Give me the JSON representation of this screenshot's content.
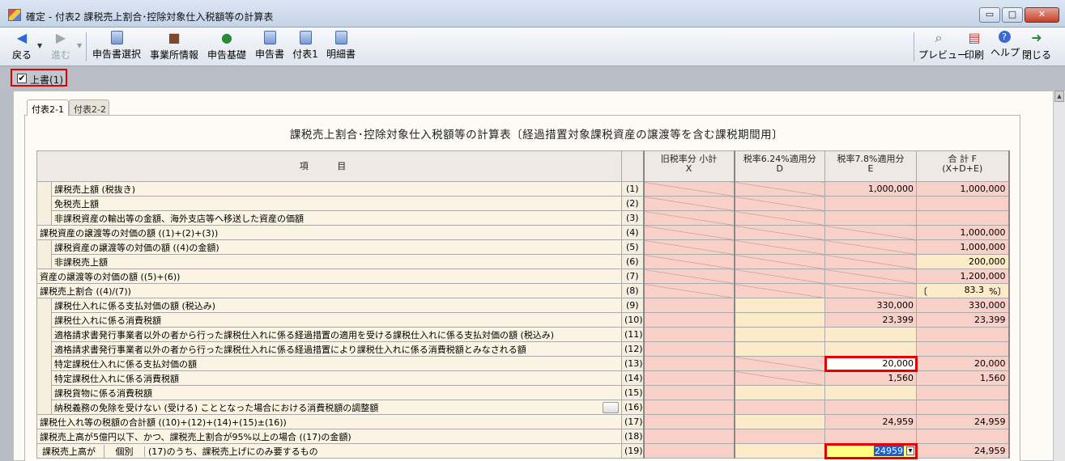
{
  "window": {
    "title": "確定 - 付表2 課税売上割合･控除対象仕入税額等の計算表",
    "min_label": "▭",
    "max_label": "□",
    "close_label": "✕"
  },
  "toolbar": {
    "back": "戻る",
    "forward": "進む",
    "select_return": "申告書選択",
    "business_info": "事業所情報",
    "base": "申告基礎",
    "return_form": "申告書",
    "appendix1": "付表1",
    "details": "明細書",
    "preview": "プレビュー",
    "print": "印刷",
    "help": "ヘルプ",
    "close": "閉じる"
  },
  "overwrite": {
    "label": "上書(1)",
    "checked": "✔"
  },
  "tabs": [
    "付表2-1",
    "付表2-2"
  ],
  "page_title": "課税売上割合･控除対象仕入税額等の計算表〔経過措置対象課税資産の譲渡等を含む課税期間用〕",
  "columns": {
    "item": "項 目",
    "x_line1": "旧税率分 小計",
    "x_line2": "X",
    "d_line1": "税率6.24%適用分",
    "d_line2": "D",
    "e_line1": "税率7.8%適用分",
    "e_line2": "E",
    "f_line1": "合 計 F",
    "f_line2": "(X+D+E)"
  },
  "rows": [
    {
      "label": "課税売上額 (税抜き)",
      "num": "(1)",
      "e": "1,000,000",
      "f": "1,000,000"
    },
    {
      "label": "免税売上額",
      "num": "(2)",
      "e": "",
      "f": ""
    },
    {
      "label": "非課税資産の輸出等の金額、海外支店等へ移送した資産の価額",
      "num": "(3)",
      "e": "",
      "f": ""
    },
    {
      "label": "課税資産の譲渡等の対価の額 ((1)+(2)+(3))",
      "num": "(4)",
      "f": "1,000,000"
    },
    {
      "label": "課税資産の譲渡等の対価の額 ((4)の金額)",
      "num": "(5)",
      "f": "1,000,000"
    },
    {
      "label": "非課税売上額",
      "num": "(6)",
      "f": "200,000"
    },
    {
      "label": "資産の譲渡等の対価の額 ((5)+(6))",
      "num": "(7)",
      "f": "1,200,000"
    },
    {
      "label": "課税売上割合 ((4)/(7))",
      "num": "(8)",
      "f_open": "〔",
      "f": "83.3",
      "f_close": "%〕"
    },
    {
      "label": "課税仕入れに係る支払対価の額 (税込み)",
      "num": "(9)",
      "e": "330,000",
      "f": "330,000"
    },
    {
      "label": "課税仕入れに係る消費税額",
      "num": "(10)",
      "e": "23,399",
      "f": "23,399"
    },
    {
      "label": "適格請求書発行事業者以外の者から行った課税仕入れに係る経過措置の適用を受ける課税仕入れに係る支払対価の額 (税込み)",
      "num": "(11)",
      "e": "",
      "f": ""
    },
    {
      "label": "適格請求書発行事業者以外の者から行った課税仕入れに係る経過措置により課税仕入れに係る消費税額とみなされる額",
      "num": "(12)",
      "e": "",
      "f": ""
    },
    {
      "label": "特定課税仕入れに係る支払対価の額",
      "num": "(13)",
      "e": "20,000",
      "f": "20,000"
    },
    {
      "label": "特定課税仕入れに係る消費税額",
      "num": "(14)",
      "e": "1,560",
      "f": "1,560"
    },
    {
      "label": "課税貨物に係る消費税額",
      "num": "(15)",
      "e": "",
      "f": ""
    },
    {
      "label": "納税義務の免除を受けない (受ける) こととなった場合における消費税額の調整額",
      "num": "(16)",
      "e": "",
      "f": ""
    },
    {
      "label": "課税仕入れ等の税額の合計額 ((10)+(12)+(14)+(15)±(16))",
      "num": "(17)",
      "e": "24,959",
      "f": "24,959"
    },
    {
      "label": "課税売上高が5億円以下、かつ、課税売上割合が95%以上の場合 ((17)の金額)",
      "num": "(18)",
      "e": "",
      "f": ""
    },
    {
      "label": "(17)のうち、課税売上げにのみ要するもの",
      "num": "(19)",
      "e": "24959",
      "f": "24,959"
    }
  ],
  "row19_group1": "課税売上高が",
  "row19_group2": "個別"
}
